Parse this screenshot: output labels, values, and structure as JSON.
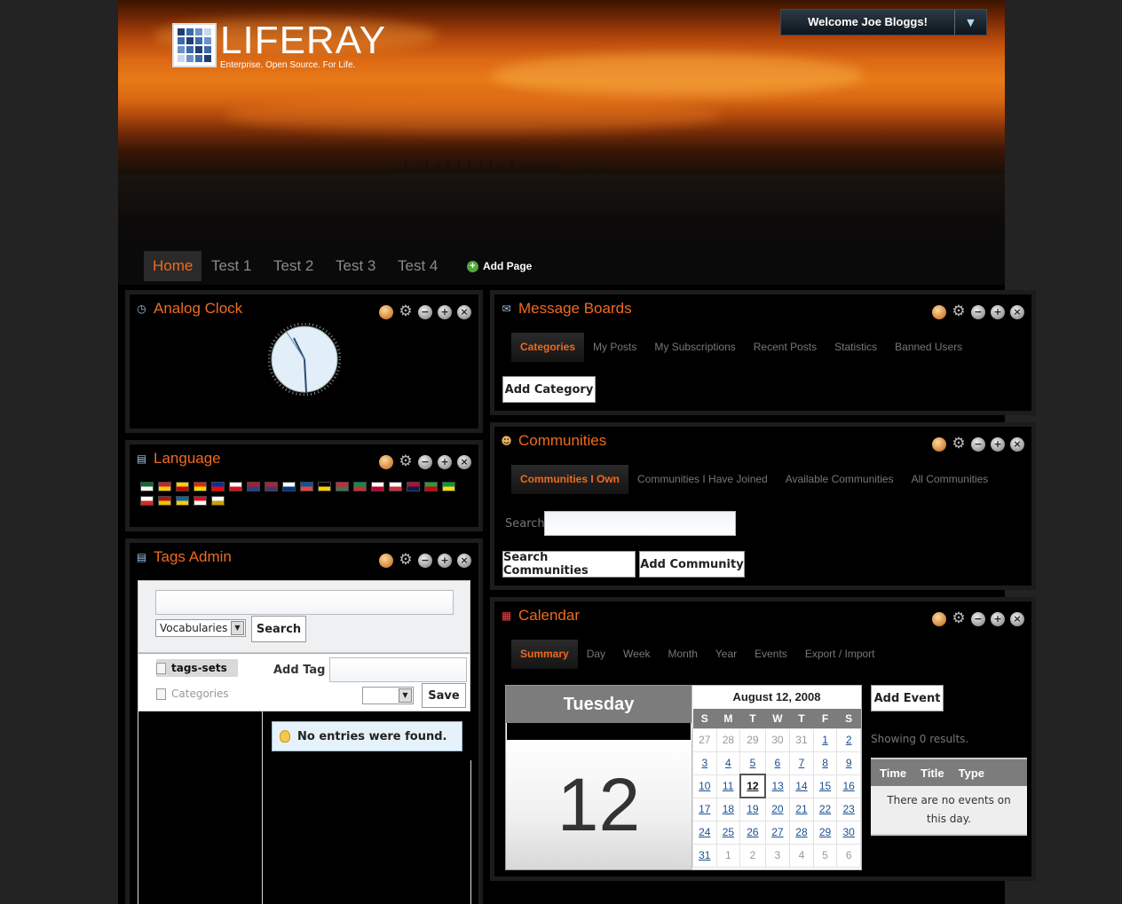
{
  "header": {
    "logo_word": "LIFERAY",
    "logo_tagline": "Enterprise. Open Source. For Life.",
    "welcome_text": "Welcome Joe Bloggs!"
  },
  "nav": {
    "items": [
      {
        "label": "Home",
        "active": true
      },
      {
        "label": "Test 1"
      },
      {
        "label": "Test 2"
      },
      {
        "label": "Test 3"
      },
      {
        "label": "Test 4"
      }
    ],
    "add_page": "Add Page"
  },
  "analog_clock": {
    "title": "Analog Clock"
  },
  "language": {
    "title": "Language",
    "flags": [
      [
        "#0b6e2f",
        "#fff"
      ],
      [
        "#d02030",
        "#f5d000"
      ],
      [
        "#f5d000",
        "#c00"
      ],
      [
        "#de2910",
        "#ffde00"
      ],
      [
        "#0033a0",
        "#fe0000"
      ],
      [
        "#fff",
        "#d7141a"
      ],
      [
        "#ae1c28",
        "#21468b"
      ],
      [
        "#b22234",
        "#3c3b6e"
      ],
      [
        "#fff",
        "#003580"
      ],
      [
        "#0055a4",
        "#ef4135"
      ],
      [
        "#000",
        "#ffce00"
      ],
      [
        "#ce2939",
        "#477050"
      ],
      [
        "#009246",
        "#ce2b37"
      ],
      [
        "#fff",
        "#bc002d"
      ],
      [
        "#fff",
        "#cd2e3a"
      ],
      [
        "#ba0c2f",
        "#00205b"
      ],
      [
        "#239f40",
        "#da0000"
      ],
      [
        "#009c3b",
        "#ffdf00"
      ],
      [
        "#fff",
        "#d52b1e"
      ],
      [
        "#aa151b",
        "#f1bf00"
      ],
      [
        "#006aa7",
        "#fecc00"
      ],
      [
        "#e30a17",
        "#fff"
      ],
      [
        "#fff",
        "#c8a200"
      ]
    ]
  },
  "tags_admin": {
    "title": "Tags Admin",
    "vocab_select": "Vocabularies",
    "search_button": "Search",
    "tree_items": [
      "tags-sets",
      "Categories"
    ],
    "add_tag_label": "Add Tag",
    "save_button": "Save",
    "no_entries": "No entries were found."
  },
  "message_boards": {
    "title": "Message Boards",
    "tabs": [
      "Categories",
      "My Posts",
      "My Subscriptions",
      "Recent Posts",
      "Statistics",
      "Banned Users"
    ],
    "add_category": "Add Category"
  },
  "communities": {
    "title": "Communities",
    "tabs": [
      "Communities I Own",
      "Communities I Have Joined",
      "Available Communities",
      "All Communities"
    ],
    "search_label": "Search",
    "search_button": "Search Communities",
    "add_button": "Add Community"
  },
  "calendar": {
    "title": "Calendar",
    "tabs": [
      "Summary",
      "Day",
      "Week",
      "Month",
      "Year",
      "Events",
      "Export / Import"
    ],
    "day_name": "Tuesday",
    "day_number": "12",
    "month_header": "August 12, 2008",
    "weekdays": [
      "S",
      "M",
      "T",
      "W",
      "T",
      "F",
      "S"
    ],
    "weeks": [
      [
        {
          "d": "27",
          "o": true
        },
        {
          "d": "28",
          "o": true
        },
        {
          "d": "29",
          "o": true
        },
        {
          "d": "30",
          "o": true
        },
        {
          "d": "31",
          "o": true
        },
        {
          "d": "1"
        },
        {
          "d": "2"
        }
      ],
      [
        {
          "d": "3"
        },
        {
          "d": "4"
        },
        {
          "d": "5"
        },
        {
          "d": "6"
        },
        {
          "d": "7"
        },
        {
          "d": "8"
        },
        {
          "d": "9"
        }
      ],
      [
        {
          "d": "10"
        },
        {
          "d": "11"
        },
        {
          "d": "12",
          "t": true
        },
        {
          "d": "13"
        },
        {
          "d": "14"
        },
        {
          "d": "15"
        },
        {
          "d": "16"
        }
      ],
      [
        {
          "d": "17"
        },
        {
          "d": "18"
        },
        {
          "d": "19"
        },
        {
          "d": "20"
        },
        {
          "d": "21"
        },
        {
          "d": "22"
        },
        {
          "d": "23"
        }
      ],
      [
        {
          "d": "24"
        },
        {
          "d": "25"
        },
        {
          "d": "26"
        },
        {
          "d": "27"
        },
        {
          "d": "28"
        },
        {
          "d": "29"
        },
        {
          "d": "30"
        }
      ],
      [
        {
          "d": "31"
        },
        {
          "d": "1",
          "o": true
        },
        {
          "d": "2",
          "o": true
        },
        {
          "d": "3",
          "o": true
        },
        {
          "d": "4",
          "o": true
        },
        {
          "d": "5",
          "o": true
        },
        {
          "d": "6",
          "o": true
        }
      ]
    ],
    "add_event": "Add Event",
    "showing": "Showing 0 results.",
    "event_columns": [
      "Time",
      "Title",
      "Type"
    ],
    "no_events": "There are no events on this day."
  },
  "portlet_tools": [
    "palette-icon",
    "gear-icon",
    "minimize-icon",
    "maximize-icon",
    "close-icon"
  ],
  "colors": {
    "accent": "#f06a1e",
    "panel_bg": "#000000",
    "page_bg": "#232323",
    "link": "#1a4f90"
  }
}
